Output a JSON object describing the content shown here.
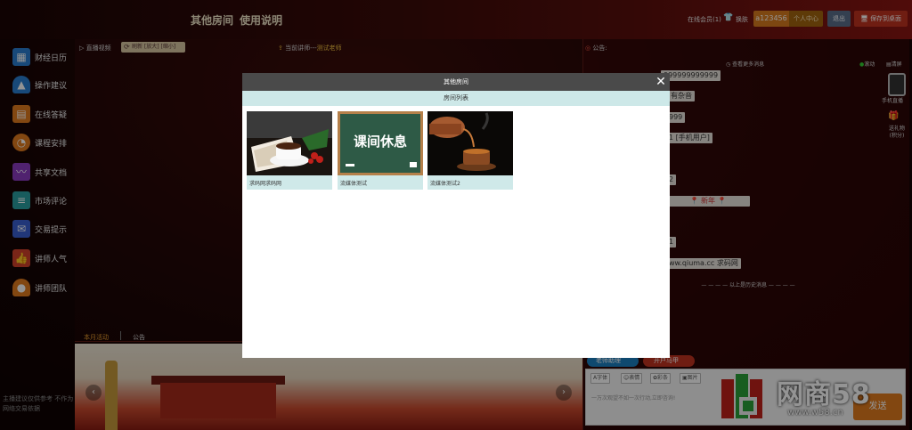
{
  "header": {
    "nav": [
      "其他房间",
      "使用说明"
    ],
    "online_members": "在线会员(1)",
    "skin_label": "换肤",
    "username": "a123456",
    "user_center": "个人中心",
    "logout": "退出",
    "save_desktop": "保存到桌面"
  },
  "sidebar": {
    "items": [
      {
        "label": "财经日历",
        "icon": "calendar-icon",
        "color": "#2a7fd0"
      },
      {
        "label": "操作建议",
        "icon": "bell-icon",
        "color": "#2a7fd0"
      },
      {
        "label": "在线答疑",
        "icon": "document-icon",
        "color": "#e07a1e"
      },
      {
        "label": "课程安排",
        "icon": "clock-icon",
        "color": "#e07a1e"
      },
      {
        "label": "共享文档",
        "icon": "chart-icon",
        "color": "#8a3cc0"
      },
      {
        "label": "市场评论",
        "icon": "books-icon",
        "color": "#2a9fa0"
      },
      {
        "label": "交易提示",
        "icon": "mail-icon",
        "color": "#3a5fd0"
      },
      {
        "label": "讲师人气",
        "icon": "thumb-icon",
        "color": "#d0402a"
      },
      {
        "label": "讲师团队",
        "icon": "person-icon",
        "color": "#e07a1e"
      }
    ],
    "disclaimer": "主播建议仅供参考 不作为网络交易依据"
  },
  "video": {
    "live_label": "直播视频",
    "refresh_label": "刷新 [放大] [缩小]",
    "lecturer_prefix": "当前讲师---",
    "lecturer_name": "测试老师"
  },
  "chat": {
    "notice_label": "公告:",
    "more_messages": "查看更多消息",
    "scroll_label": "滚动",
    "clear_label": "清屏",
    "messages": [
      "999999999999",
      "有杂音",
      "999",
      "1 [手机用户]",
      "2",
      "📍 新年 📍",
      "1",
      "ww.qiuma.cc 求码网"
    ],
    "history_label": "以上是历史消息",
    "mobile_label": "手机直播",
    "gift_label": "送礼物(积分)",
    "tag_teacher": "老师助理",
    "tag_account": "开户马甲",
    "tools": [
      "字体",
      "表情",
      "彩条",
      "图片"
    ],
    "input_placeholder": "一万次观望不如一次行动,立即咨询!",
    "send_label": "发送"
  },
  "bottom": {
    "tab_active": "本月活动",
    "tab_other": "公告"
  },
  "watermark": {
    "brand": "网商58",
    "url": "www.w58.cn"
  },
  "modal": {
    "title": "其他房间",
    "subtitle": "房间列表",
    "rooms": [
      {
        "name": "求码网求码网"
      },
      {
        "name": "流媒体测试",
        "image_text": "课间休息"
      },
      {
        "name": "流媒体测试2"
      }
    ]
  }
}
